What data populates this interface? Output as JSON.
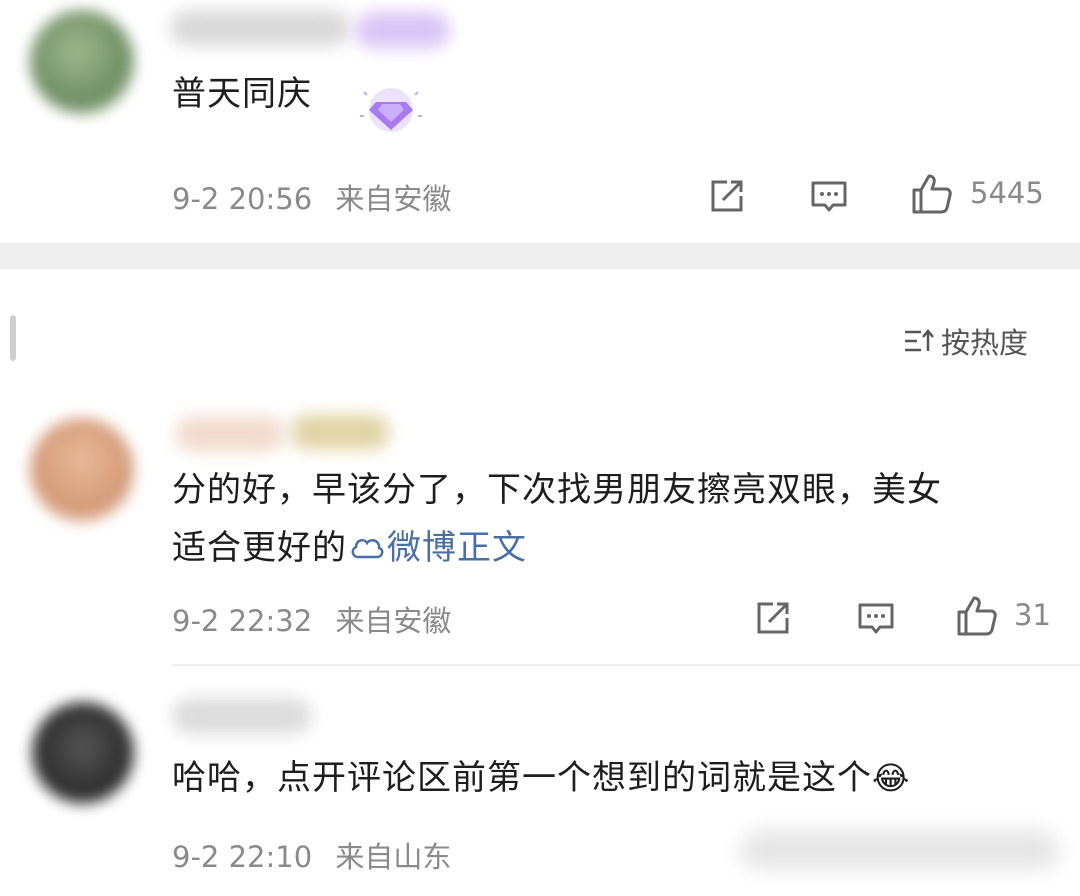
{
  "comments": [
    {
      "text": "普天同庆",
      "time": "9-2 20:56",
      "location": "来自安徽",
      "likes": "5445",
      "avatar_color": "#7c9a6e"
    },
    {
      "text_line1": "分的好，早该分了，下次找男朋友擦亮双眼，美女",
      "text_line2": "适合更好的",
      "link_text": "微博正文",
      "time": "9-2 22:32",
      "location": "来自安徽",
      "likes": "31",
      "avatar_color": "#d6a583"
    },
    {
      "text": "哈哈，点开评论区前第一个想到的词就是这个",
      "emoji": "😂",
      "time": "9-2 22:10",
      "location": "来自山东",
      "avatar_color": "#3a3a3a"
    }
  ],
  "sort": {
    "label": "按热度"
  },
  "icons": {
    "share": "share-icon",
    "comment": "comment-icon",
    "like": "thumbs-up-icon",
    "badge": "diamond-badge-icon",
    "sort": "sort-icon",
    "link": "weibo-link-icon"
  },
  "colors": {
    "link": "#4a6fa5",
    "meta": "#8a8a8a",
    "badge": "#9b6cf0"
  }
}
